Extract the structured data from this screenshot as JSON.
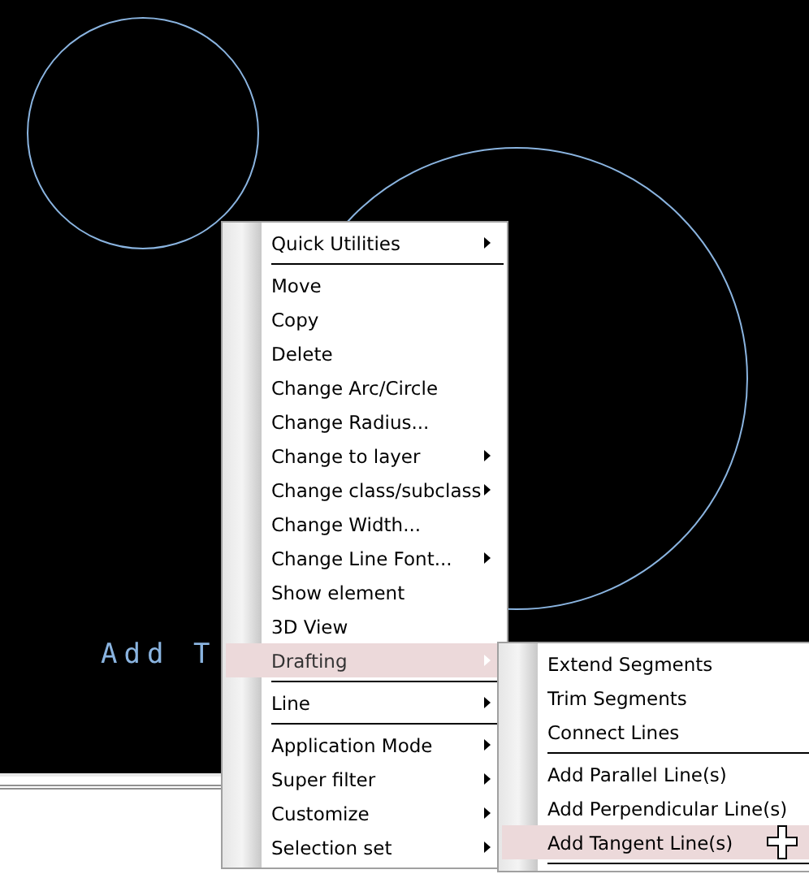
{
  "canvas": {
    "text": "Add T"
  },
  "context_menu": {
    "items": [
      {
        "kind": "item",
        "label": "Quick Utilities",
        "submenu": true,
        "selected": false
      },
      {
        "kind": "separator"
      },
      {
        "kind": "item",
        "label": "Move",
        "submenu": false,
        "selected": false
      },
      {
        "kind": "item",
        "label": "Copy",
        "submenu": false,
        "selected": false
      },
      {
        "kind": "item",
        "label": "Delete",
        "submenu": false,
        "selected": false
      },
      {
        "kind": "item",
        "label": "Change Arc/Circle",
        "submenu": false,
        "selected": false
      },
      {
        "kind": "item",
        "label": "Change Radius...",
        "submenu": false,
        "selected": false
      },
      {
        "kind": "item",
        "label": "Change to layer",
        "submenu": true,
        "selected": false
      },
      {
        "kind": "item",
        "label": "Change class/subclass",
        "submenu": true,
        "selected": false
      },
      {
        "kind": "item",
        "label": "Change Width...",
        "submenu": false,
        "selected": false
      },
      {
        "kind": "item",
        "label": "Change Line Font...",
        "submenu": true,
        "selected": false
      },
      {
        "kind": "item",
        "label": "Show element",
        "submenu": false,
        "selected": false
      },
      {
        "kind": "item",
        "label": "3D View",
        "submenu": false,
        "selected": false
      },
      {
        "kind": "item",
        "label": "Drafting",
        "submenu": true,
        "selected": true
      },
      {
        "kind": "separator"
      },
      {
        "kind": "item",
        "label": "Line",
        "submenu": true,
        "selected": false
      },
      {
        "kind": "separator"
      },
      {
        "kind": "item",
        "label": "Application Mode",
        "submenu": true,
        "selected": false
      },
      {
        "kind": "item",
        "label": "Super filter",
        "submenu": true,
        "selected": false
      },
      {
        "kind": "item",
        "label": "Customize",
        "submenu": true,
        "selected": false
      },
      {
        "kind": "item",
        "label": "Selection set",
        "submenu": true,
        "selected": false
      }
    ]
  },
  "submenu": {
    "items": [
      {
        "kind": "item",
        "label": "Extend Segments",
        "submenu": false,
        "selected": false
      },
      {
        "kind": "item",
        "label": "Trim Segments",
        "submenu": false,
        "selected": false
      },
      {
        "kind": "item",
        "label": "Connect Lines",
        "submenu": false,
        "selected": false
      },
      {
        "kind": "separator"
      },
      {
        "kind": "item",
        "label": "Add Parallel Line(s)",
        "submenu": false,
        "selected": false
      },
      {
        "kind": "item",
        "label": "Add Perpendicular Line(s)",
        "submenu": false,
        "selected": false
      },
      {
        "kind": "item",
        "label": "Add Tangent Line(s)",
        "submenu": false,
        "selected": true
      },
      {
        "kind": "separator"
      }
    ]
  }
}
